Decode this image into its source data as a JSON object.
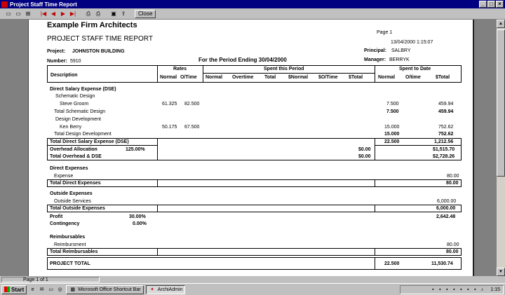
{
  "window": {
    "title": "Project Staff Time Report",
    "min": "_",
    "max": "□",
    "close": "×"
  },
  "toolbar": {
    "close_label": "Close"
  },
  "report": {
    "firm": "Example Firm Architects",
    "title": "PROJECT STAFF TIME REPORT",
    "page": "Page 1",
    "datetime": "13/04/2000 1:15:07",
    "project_label": "Project:",
    "project": "JOHNSTON BUILDING",
    "number_label": "Number:",
    "number": "5910",
    "period": "For the Period Ending 30/04/2000",
    "principal_label": "Principal:",
    "principal": "SALBRY",
    "manager_label": "Manager:",
    "manager": "BERRYK",
    "headers": {
      "description": "Description",
      "rates": "Rates",
      "rate_normal": "Normal",
      "rate_ot": "O/Time",
      "spent_period": "Spent this Period",
      "sp_normal": "Normal",
      "sp_overtime": "Overtime",
      "sp_total": "Total",
      "sp_dnormal": "$Normal",
      "sp_dot": "$O/Time",
      "sp_dtotal": "$Total",
      "spent_date": "Spent to Date",
      "sd_normal": "Normal",
      "sd_ot": "O/time",
      "sd_dtotal": "$Total"
    },
    "dse_section": "Direct Salary Expense (DSE)",
    "schematic": "Schematic Design",
    "steve": {
      "name": "Steve Groom",
      "rate_n": "61.325",
      "rate_o": "82.500",
      "sd_n": "7.500",
      "sd_t": "459.94"
    },
    "total_schematic": {
      "label": "Total Schematic Design",
      "sd_n": "7.500",
      "sd_t": "459.94"
    },
    "design_dev": "Design Development",
    "ken": {
      "name": "Ken Berry",
      "rate_n": "50.175",
      "rate_o": "67.500",
      "sd_n": "15.000",
      "sd_t": "752.62"
    },
    "total_design_dev": {
      "label": "Total Design Development",
      "sd_n": "15.000",
      "sd_t": "752.62"
    },
    "total_dse": {
      "label": "Total Direct Salary Expense (DSE)",
      "sd_n": "22.500",
      "sd_t": "1,212.56"
    },
    "overhead": {
      "label": "Overhead Allocation",
      "pct": "125.00%",
      "sp_t": "$0.00",
      "sd_t": "$1,515.70"
    },
    "total_overhead": {
      "label": "Total Overhead & DSE",
      "sp_t": "$0.00",
      "sd_t": "$2,728.26"
    },
    "direct_section": "Direct Expenses",
    "expense": {
      "label": "Expense",
      "sd_t": "80.00"
    },
    "total_direct": {
      "label": "Total Direct Expenses",
      "sd_t": "80.00"
    },
    "outside_section": "Outside Expenses",
    "outside_services": {
      "label": "Outside Services",
      "sd_t": "6,000.00"
    },
    "total_outside": {
      "label": "Total Outside Expenses",
      "sd_t": "6,000.00"
    },
    "profit": {
      "label": "Profit",
      "pct": "30.00%",
      "sd_t": "2,642.48"
    },
    "contingency": {
      "label": "Contingency",
      "pct": "0.00%"
    },
    "reimb_section": "Reimbursables",
    "reimbursment": {
      "label": "Reimbursment",
      "sd_t": "80.00"
    },
    "total_reimb": {
      "label": "Total Reimbursables",
      "sd_t": "80.00"
    },
    "project_total": {
      "label": "PROJECT TOTAL",
      "sd_n": "22.500",
      "sd_t": "11,530.74"
    }
  },
  "status": {
    "page": "Page 1 of 1"
  },
  "taskbar": {
    "start": "Start",
    "task1": "Microsoft Office Shortcut Bar",
    "task2": "ArchiAdmin",
    "clock": "1:15"
  }
}
